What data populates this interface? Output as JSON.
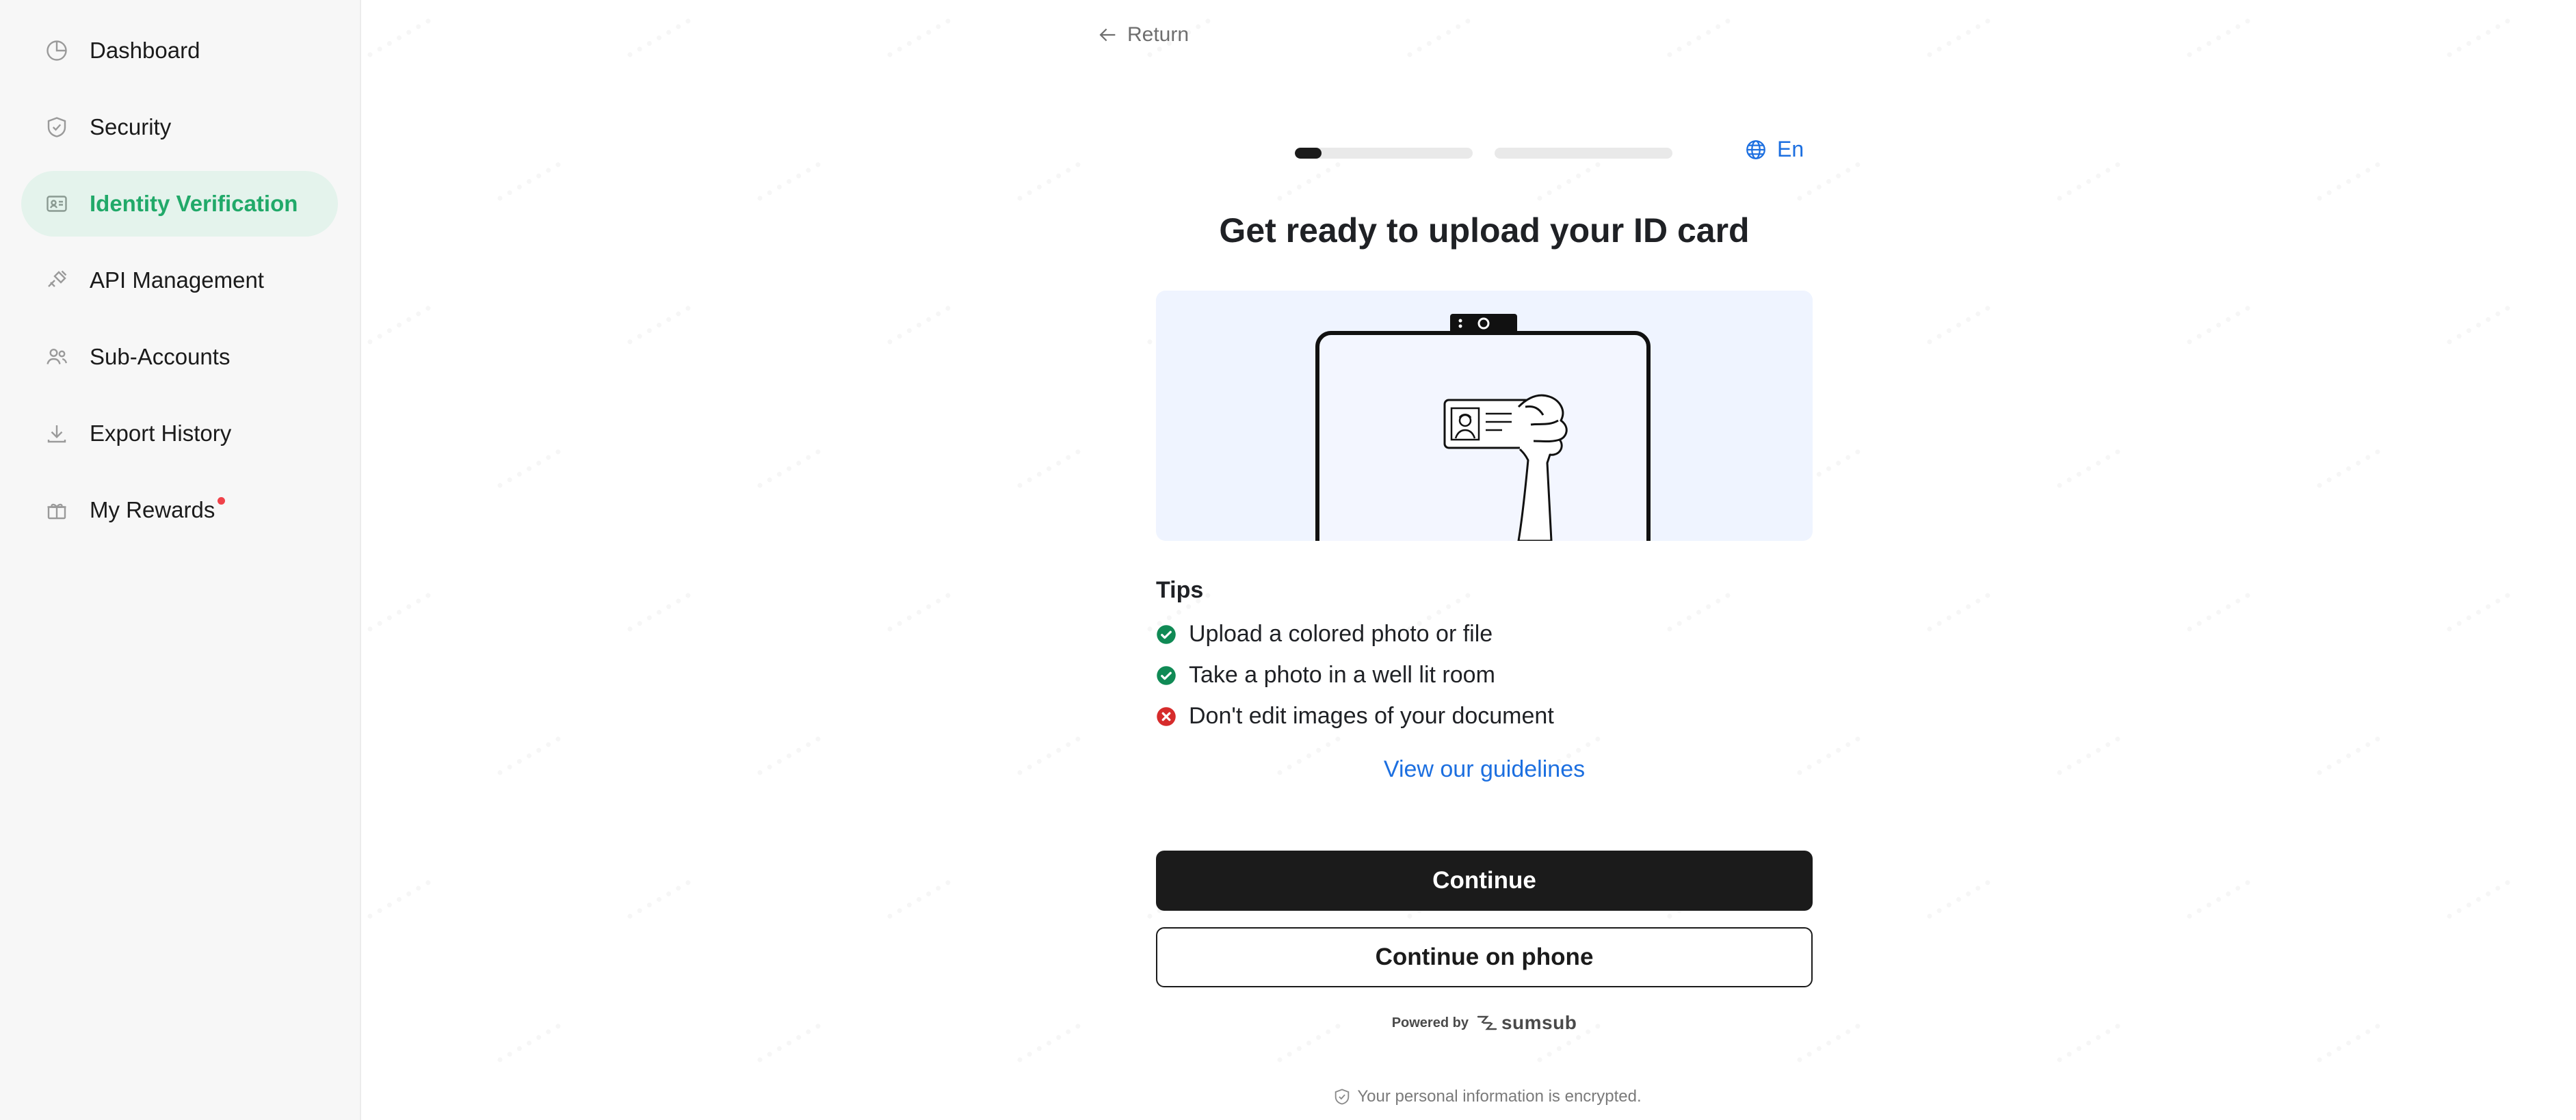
{
  "sidebar": {
    "items": [
      {
        "label": "Dashboard",
        "icon": "dashboard-icon"
      },
      {
        "label": "Security",
        "icon": "shield-icon"
      },
      {
        "label": "Identity Verification",
        "icon": "id-card-icon",
        "active": true
      },
      {
        "label": "API Management",
        "icon": "api-icon"
      },
      {
        "label": "Sub-Accounts",
        "icon": "users-icon"
      },
      {
        "label": "Export History",
        "icon": "download-icon"
      },
      {
        "label": "My Rewards",
        "icon": "gift-icon",
        "badge": "red-dot"
      }
    ]
  },
  "main": {
    "return_label": "Return",
    "language": "En",
    "progress": {
      "steps": 2,
      "current_step_fraction": 0.15
    },
    "title": "Get ready to upload your ID card",
    "tips_title": "Tips",
    "tips": [
      {
        "text": "Upload a colored photo or file",
        "status": "ok"
      },
      {
        "text": "Take a photo in a well lit room",
        "status": "ok"
      },
      {
        "text": "Don't edit images of your document",
        "status": "error"
      }
    ],
    "guidelines_link": "View our guidelines",
    "continue_button": "Continue",
    "continue_phone_button": "Continue on phone",
    "powered_by": "Powered by",
    "powered_brand": "sumsub",
    "encrypted_note": "Your personal information is encrypted."
  },
  "colors": {
    "accent_green": "#21a969",
    "link_blue": "#1c6fe0",
    "primary_dark": "#1b1b1b",
    "ok_green": "#108a55",
    "error_red": "#d62b2b",
    "illustration_bg": "#eff4ff"
  }
}
